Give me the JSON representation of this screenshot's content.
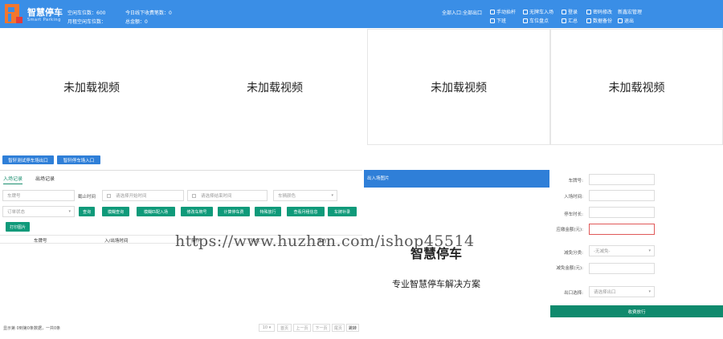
{
  "header": {
    "app_title": "智慧停车",
    "app_subtitle": "Smart Parking",
    "stats": {
      "empty_spaces": "空闲车位数：600",
      "monthly_empty_spaces": "月租空闲车位数：",
      "today_offline_fee_count": "今日线下收费笔数：0",
      "total_amount": "总金额：0"
    },
    "entry_status": "全部入口:全部出口",
    "tools": [
      {
        "label": "手动抬杆",
        "icon": "hand-icon"
      },
      {
        "label": "无牌车入场",
        "icon": "car-icon"
      },
      {
        "label": "登录",
        "icon": "login-icon"
      },
      {
        "label": "密码修改",
        "icon": "lock-icon"
      },
      {
        "label": "新鑫宏管理",
        "icon": ""
      },
      {
        "label": "下班",
        "icon": "offduty-icon"
      },
      {
        "label": "车位盘点",
        "icon": "count-icon"
      },
      {
        "label": "汇总",
        "icon": "summary-icon"
      },
      {
        "label": "数据备份",
        "icon": "backup-icon"
      },
      {
        "label": "退出",
        "icon": "exit-icon"
      }
    ]
  },
  "videos": [
    {
      "label": "未加载视频"
    },
    {
      "label": "未加载视频"
    },
    {
      "label": "未加载视频"
    },
    {
      "label": "未加载视频"
    }
  ],
  "entry_buttons": {
    "exit_test": "智轩测试停车场出口",
    "entry_test": "智轩停车场入口"
  },
  "left_panel": {
    "tabs": [
      "入场记录",
      "出场记录"
    ],
    "plate_placeholder": "车牌号",
    "end_time_label": "截止时间",
    "start_time_placeholder": "请选择开始时间",
    "end_time_placeholder": "请选择结束时间",
    "color_placeholder": "车辆颜色",
    "order_status_placeholder": "订单状态",
    "buttons": [
      "查询",
      "模糊查询",
      "模糊匹配入场",
      "修改车牌号",
      "计算停车费",
      "特殊放行",
      "查看月租信息",
      "车牌补录"
    ],
    "print_button": "打印图片",
    "table_headers": [
      "车牌号",
      "入/出场时间",
      "操作",
      "状态",
      "场内"
    ],
    "pager_info": "显示第 0到第0条数据，一共0条",
    "page_size": "10",
    "pager_buttons": [
      "首页",
      "上一页",
      "下一页",
      "尾页",
      "跳转"
    ]
  },
  "center_panel": {
    "header": "出入场图片",
    "brand_title": "智慧停车",
    "brand_subtitle": "专业智慧停车解决方案"
  },
  "right_panel": {
    "fields": [
      {
        "label": "车牌号:",
        "value": ""
      },
      {
        "label": "入场时间:",
        "value": ""
      },
      {
        "label": "停车时长:",
        "value": ""
      },
      {
        "label": "应缴金额(元):",
        "value": ""
      },
      {
        "label": "减免分类:",
        "value": "-无减免-"
      },
      {
        "label": "减免金额(元):",
        "value": ""
      },
      {
        "label": "出口选择:",
        "value": "请选择出口"
      }
    ],
    "pay_button": "收费放行"
  },
  "watermark": "https://www.huzhan.com/ishop45514",
  "colors": {
    "header_blue": "#3a8ee6",
    "button_blue": "#2f7fd8",
    "button_green": "#0f9a7a",
    "error_red": "#e05858"
  }
}
